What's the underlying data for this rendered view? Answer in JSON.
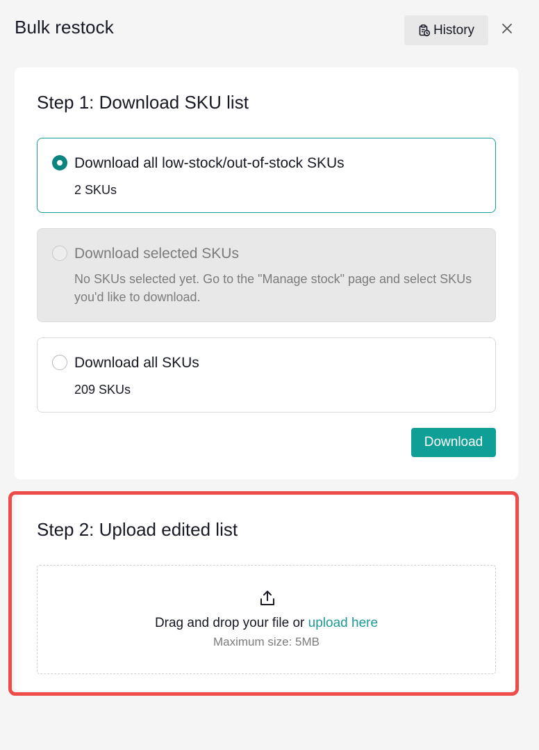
{
  "header": {
    "title": "Bulk restock",
    "history_label": "History"
  },
  "step1": {
    "title": "Step 1: Download SKU list",
    "options": [
      {
        "label": "Download all low-stock/out-of-stock SKUs",
        "sub": "2 SKUs",
        "state": "selected"
      },
      {
        "label": "Download selected SKUs",
        "sub": "No SKUs selected yet. Go to the \"Manage stock\" page and select SKUs you'd like to download.",
        "state": "disabled"
      },
      {
        "label": "Download all SKUs",
        "sub": "209 SKUs",
        "state": "unselected"
      }
    ],
    "download_label": "Download"
  },
  "step2": {
    "title": "Step 2: Upload edited list",
    "drop_prefix": "Drag and drop your file or ",
    "drop_link": "upload here",
    "max_size": "Maximum size: 5MB"
  },
  "colors": {
    "accent": "#109f97",
    "highlight": "#ee4b4b"
  },
  "icons": {
    "history": "clipboard-clock-icon",
    "close": "close-icon",
    "upload": "upload-icon"
  }
}
